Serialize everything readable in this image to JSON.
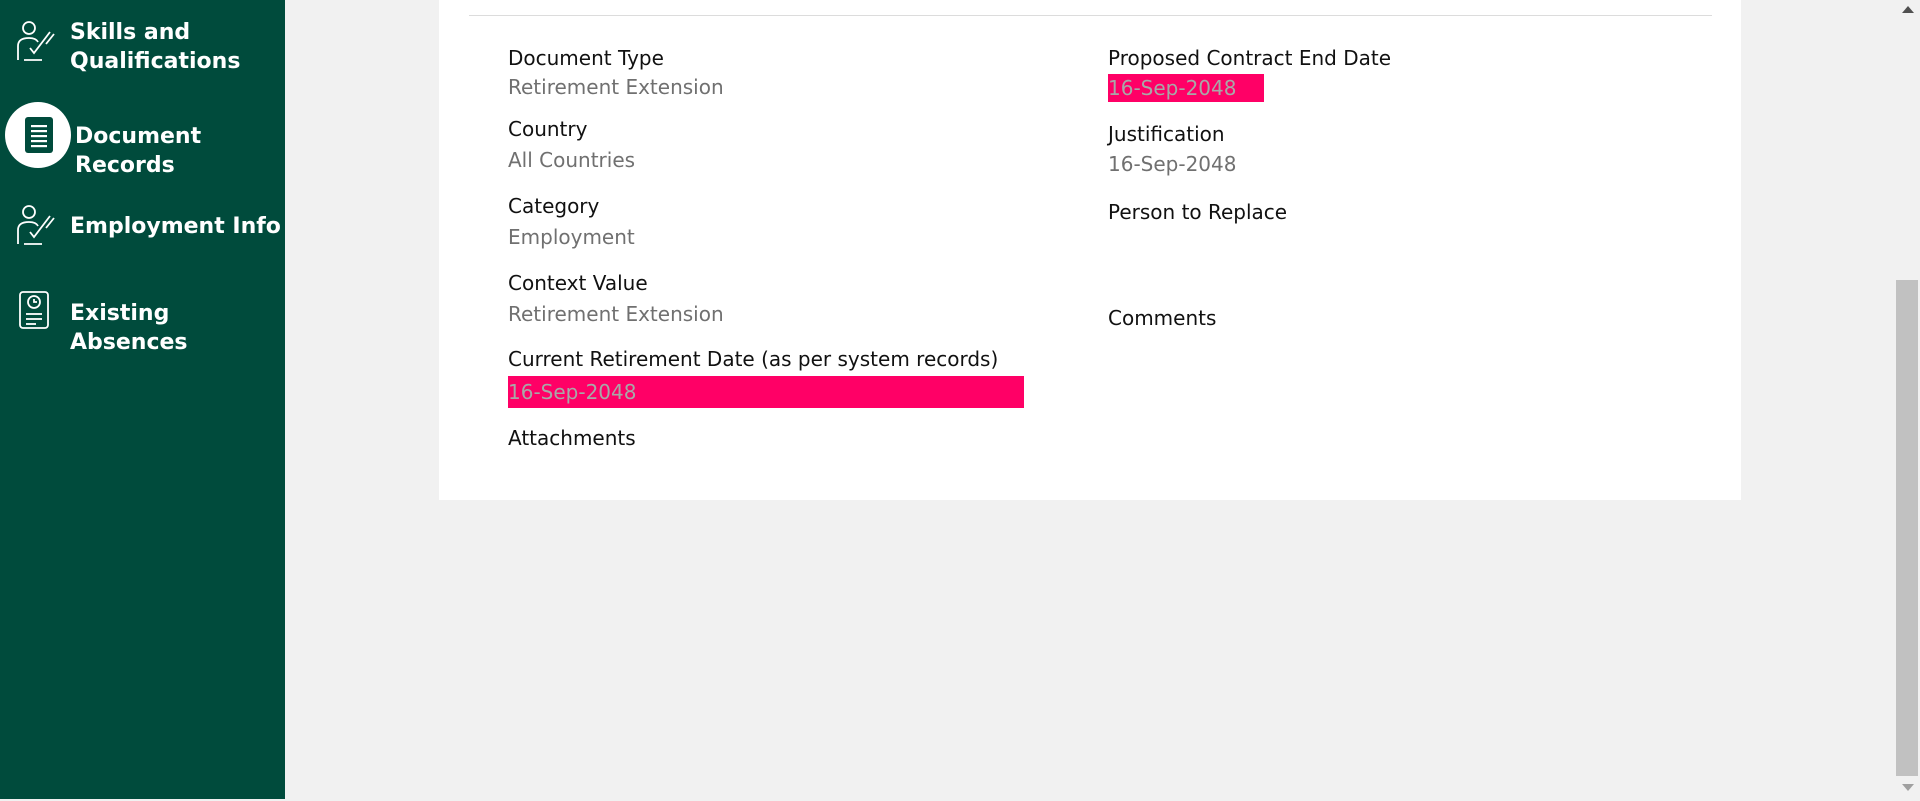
{
  "sidebar": {
    "items": [
      {
        "label": "Skills and Qualifications",
        "icon": "person-check-icon"
      },
      {
        "label": "Document Records",
        "icon": "document-icon",
        "active": true
      },
      {
        "label": "Employment Info",
        "icon": "person-check-icon"
      },
      {
        "label": "Existing Absences",
        "icon": "clock-document-icon"
      }
    ],
    "colors": {
      "background": "#004b3c",
      "active_circle": "#ffffff"
    }
  },
  "details": {
    "document_type": {
      "label": "Document Type",
      "value": "Retirement Extension"
    },
    "country": {
      "label": "Country",
      "value": "All Countries"
    },
    "category": {
      "label": "Category",
      "value": "Employment"
    },
    "context_value": {
      "label": "Context Value",
      "value": "Retirement Extension"
    },
    "current_retirement_date": {
      "label": "Current Retirement Date (as per system records)",
      "value": "16-Sep-2048"
    },
    "attachments": {
      "label": "Attachments"
    },
    "proposed_contract_end_date": {
      "label": "Proposed Contract End Date",
      "value": "16-Sep-2048"
    },
    "justification": {
      "label": "Justification",
      "value": "16-Sep-2048"
    },
    "person_to_replace": {
      "label": "Person to Replace"
    },
    "comments": {
      "label": "Comments"
    }
  },
  "colors": {
    "highlight": "#ff0066",
    "label": "#111111",
    "value": "#707070"
  }
}
